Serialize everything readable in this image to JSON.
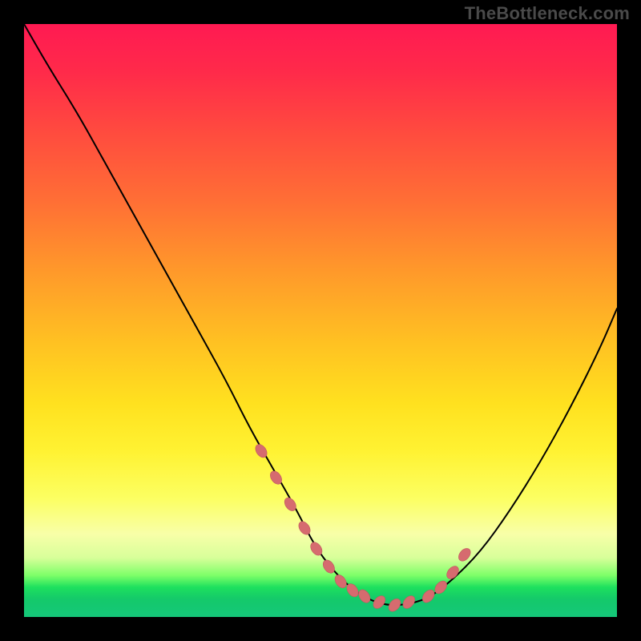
{
  "watermark": "TheBottleneck.com",
  "colors": {
    "background": "#000000",
    "curve": "#000000",
    "marker_fill": "#d66b6f",
    "marker_stroke": "#c05a5e"
  },
  "chart_data": {
    "type": "line",
    "title": "",
    "xlabel": "",
    "ylabel": "",
    "xlim": [
      0,
      100
    ],
    "ylim": [
      0,
      100
    ],
    "grid": false,
    "legend": false,
    "series": [
      {
        "name": "curve",
        "x": [
          0,
          4,
          9,
          14,
          19,
          24,
          29,
          34,
          38,
          42,
          46,
          49,
          52,
          55,
          58,
          61,
          64,
          68,
          72,
          77,
          82,
          87,
          92,
          97,
          100
        ],
        "y": [
          100,
          93,
          85,
          76,
          67,
          58,
          49,
          40,
          32,
          25,
          18,
          12,
          8,
          5,
          3,
          2,
          2,
          3,
          6,
          11,
          18,
          26,
          35,
          45,
          52
        ]
      }
    ],
    "markers": {
      "name": "highlight-points",
      "x": [
        40,
        42.5,
        44.9,
        47.3,
        49.3,
        51.4,
        53.4,
        55.4,
        57.4,
        59.9,
        62.5,
        64.9,
        68.2,
        70.3,
        72.3,
        74.3
      ],
      "y": [
        28,
        23.5,
        19,
        15,
        11.5,
        8.5,
        6,
        4.5,
        3.5,
        2.5,
        2,
        2.5,
        3.5,
        5,
        7.5,
        10.5
      ]
    }
  }
}
